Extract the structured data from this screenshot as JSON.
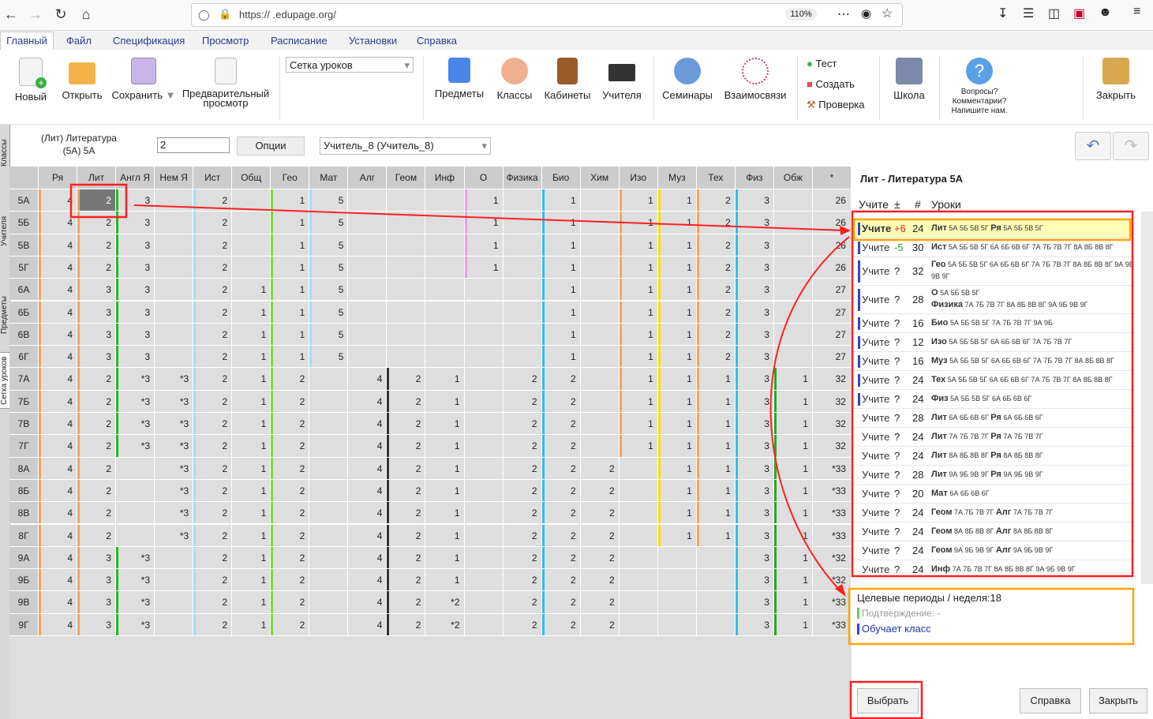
{
  "browser": {
    "url": "https://       .edupage.org/",
    "zoom": "110%"
  },
  "menu": [
    "Главный",
    "Файл",
    "Спецификация",
    "Просмотр",
    "Расписание",
    "Установки",
    "Справка"
  ],
  "toolbar": {
    "new": "Новый",
    "open": "Открыть",
    "save": "Сохранить",
    "preview": [
      "Предварительный",
      "просмотр"
    ],
    "view_select": "Сетка уроков",
    "subjects": "Предметы",
    "classes": "Классы",
    "rooms": "Кабинеты",
    "teachers": "Учителя",
    "seminars": "Семинары",
    "relations": "Взаимосвязи",
    "test": "Тест",
    "create": "Создать",
    "check": "Проверка",
    "school": "Школа",
    "questions": [
      "Вопросы?",
      "Комментарии?",
      "Напишите нам."
    ],
    "close": "Закрыть"
  },
  "vertical_tabs": [
    "Сетка уроков",
    "Предметы",
    "Учителя",
    "Классы"
  ],
  "header": {
    "subject_line1": "(Лит) Литература",
    "subject_line2": "(5А) 5А",
    "count_value": "2",
    "options_label": "Опции",
    "teacher_select": "Учитель_8 (Учитель_8)"
  },
  "grid": {
    "columns": [
      "Ря",
      "Лит",
      "Англ Я",
      "Нем Я",
      "Ист",
      "Общ",
      "Гео",
      "Мат",
      "Алг",
      "Геом",
      "Инф",
      "О",
      "Физика",
      "Био",
      "Хим",
      "Изо",
      "Муз",
      "Тех",
      "Физ",
      "Обж",
      "*"
    ],
    "column_colors": [
      "#f5a35c",
      "#f5a35c",
      "#22bb22",
      "#cccccc",
      "#99e0ff",
      "#cccccc",
      "#77dd33",
      "#99e0ff",
      "#cccccc",
      "#333333",
      "#cccccc",
      "#ee99ee",
      "#cccccc",
      "#33bbee",
      "#cccccc",
      "#f5a35c",
      "#f3e000",
      "#f5a35c",
      "#33bbee",
      "#22aa22",
      "#cccccc"
    ],
    "rows": [
      {
        "label": "5А",
        "cells": [
          "4",
          "2",
          "3",
          "",
          "2",
          "",
          "1",
          "5",
          "",
          "",
          "",
          "1",
          "",
          "1",
          "",
          "1",
          "1",
          "2",
          "3",
          "",
          "26"
        ]
      },
      {
        "label": "5Б",
        "cells": [
          "4",
          "2",
          "3",
          "",
          "2",
          "",
          "1",
          "5",
          "",
          "",
          "",
          "1",
          "",
          "1",
          "",
          "1",
          "1",
          "2",
          "3",
          "",
          "26"
        ]
      },
      {
        "label": "5В",
        "cells": [
          "4",
          "2",
          "3",
          "",
          "2",
          "",
          "1",
          "5",
          "",
          "",
          "",
          "1",
          "",
          "1",
          "",
          "1",
          "1",
          "2",
          "3",
          "",
          "26"
        ]
      },
      {
        "label": "5Г",
        "cells": [
          "4",
          "2",
          "3",
          "",
          "2",
          "",
          "1",
          "5",
          "",
          "",
          "",
          "1",
          "",
          "1",
          "",
          "1",
          "1",
          "2",
          "3",
          "",
          "26"
        ]
      },
      {
        "label": "6А",
        "cells": [
          "4",
          "3",
          "3",
          "",
          "2",
          "1",
          "1",
          "5",
          "",
          "",
          "",
          "",
          "",
          "1",
          "",
          "1",
          "1",
          "2",
          "3",
          "",
          "27"
        ]
      },
      {
        "label": "6Б",
        "cells": [
          "4",
          "3",
          "3",
          "",
          "2",
          "1",
          "1",
          "5",
          "",
          "",
          "",
          "",
          "",
          "1",
          "",
          "1",
          "1",
          "2",
          "3",
          "",
          "27"
        ]
      },
      {
        "label": "6В",
        "cells": [
          "4",
          "3",
          "3",
          "",
          "2",
          "1",
          "1",
          "5",
          "",
          "",
          "",
          "",
          "",
          "1",
          "",
          "1",
          "1",
          "2",
          "3",
          "",
          "27"
        ]
      },
      {
        "label": "6Г",
        "cells": [
          "4",
          "3",
          "3",
          "",
          "2",
          "1",
          "1",
          "5",
          "",
          "",
          "",
          "",
          "",
          "1",
          "",
          "1",
          "1",
          "2",
          "3",
          "",
          "27"
        ]
      },
      {
        "label": "7А",
        "cells": [
          "4",
          "2",
          "*3",
          "*3",
          "2",
          "1",
          "2",
          "",
          "4",
          "2",
          "1",
          "",
          "2",
          "2",
          "",
          "1",
          "1",
          "1",
          "3",
          "1",
          "32"
        ]
      },
      {
        "label": "7Б",
        "cells": [
          "4",
          "2",
          "*3",
          "*3",
          "2",
          "1",
          "2",
          "",
          "4",
          "2",
          "1",
          "",
          "2",
          "2",
          "",
          "1",
          "1",
          "1",
          "3",
          "1",
          "32"
        ]
      },
      {
        "label": "7В",
        "cells": [
          "4",
          "2",
          "*3",
          "*3",
          "2",
          "1",
          "2",
          "",
          "4",
          "2",
          "1",
          "",
          "2",
          "2",
          "",
          "1",
          "1",
          "1",
          "3",
          "1",
          "32"
        ]
      },
      {
        "label": "7Г",
        "cells": [
          "4",
          "2",
          "*3",
          "*3",
          "2",
          "1",
          "2",
          "",
          "4",
          "2",
          "1",
          "",
          "2",
          "2",
          "",
          "1",
          "1",
          "1",
          "3",
          "1",
          "32"
        ]
      },
      {
        "label": "8А",
        "cells": [
          "4",
          "2",
          "",
          "*3",
          "2",
          "1",
          "2",
          "",
          "4",
          "2",
          "1",
          "",
          "2",
          "2",
          "2",
          "",
          "1",
          "1",
          "3",
          "1",
          "*33"
        ]
      },
      {
        "label": "8Б",
        "cells": [
          "4",
          "2",
          "",
          "*3",
          "2",
          "1",
          "2",
          "",
          "4",
          "2",
          "1",
          "",
          "2",
          "2",
          "2",
          "",
          "1",
          "1",
          "3",
          "1",
          "*33"
        ]
      },
      {
        "label": "8В",
        "cells": [
          "4",
          "2",
          "",
          "*3",
          "2",
          "1",
          "2",
          "",
          "4",
          "2",
          "1",
          "",
          "2",
          "2",
          "2",
          "",
          "1",
          "1",
          "3",
          "1",
          "*33"
        ]
      },
      {
        "label": "8Г",
        "cells": [
          "4",
          "2",
          "",
          "*3",
          "2",
          "1",
          "2",
          "",
          "4",
          "2",
          "1",
          "",
          "2",
          "2",
          "2",
          "",
          "1",
          "1",
          "3",
          "1",
          "*33"
        ]
      },
      {
        "label": "9А",
        "cells": [
          "4",
          "3",
          "*3",
          "",
          "2",
          "1",
          "2",
          "",
          "4",
          "2",
          "1",
          "",
          "2",
          "2",
          "2",
          "",
          "",
          "",
          "3",
          "1",
          "*32"
        ]
      },
      {
        "label": "9Б",
        "cells": [
          "4",
          "3",
          "*3",
          "",
          "2",
          "1",
          "2",
          "",
          "4",
          "2",
          "1",
          "",
          "2",
          "2",
          "2",
          "",
          "",
          "",
          "3",
          "1",
          "*32"
        ]
      },
      {
        "label": "9В",
        "cells": [
          "4",
          "3",
          "*3",
          "",
          "2",
          "1",
          "2",
          "",
          "4",
          "2",
          "*2",
          "",
          "2",
          "2",
          "2",
          "",
          "",
          "",
          "3",
          "1",
          "*33"
        ]
      },
      {
        "label": "9Г",
        "cells": [
          "4",
          "3",
          "*3",
          "",
          "2",
          "1",
          "2",
          "",
          "4",
          "2",
          "*2",
          "",
          "2",
          "2",
          "2",
          "",
          "",
          "",
          "3",
          "1",
          "*33"
        ]
      }
    ]
  },
  "panel": {
    "title": "Лит - Литература  5А",
    "col_teacher": "Учите",
    "col_diff": "±",
    "col_num": "#",
    "col_lessons": "Уроки",
    "rows": [
      {
        "t": "Учите",
        "d": "+6",
        "dc": "#e02020",
        "n": "24",
        "bar": "#3344cc",
        "lessons": [
          [
            "Лит",
            "5А 5Б 5В 5Г"
          ],
          [
            "Ря",
            "5А 5Б 5В 5Г"
          ]
        ],
        "hl": true
      },
      {
        "t": "Учите",
        "d": "-5",
        "dc": "#22aa22",
        "n": "30",
        "bar": "#3344cc",
        "lessons": [
          [
            "Ист",
            "5А 5Б 5В 5Г 6А 6Б 6В 6Г 7А 7Б 7В 7Г 8А 8Б 8В 8Г"
          ]
        ]
      },
      {
        "t": "Учите",
        "d": "?",
        "n": "32",
        "bar": "#3344cc",
        "lessons": [
          [
            "Гео",
            "5А 5Б 5В 5Г 6А 6Б 6В 6Г 7А 7Б 7В 7Г 8А 8Б 8В 8Г 9А 9Б 9В 9Г"
          ]
        ],
        "tall": true
      },
      {
        "t": "Учите",
        "d": "?",
        "n": "28",
        "bar": "#3344cc",
        "lessons": [
          [
            "О",
            "5А 5Б 5В 5Г"
          ],
          [
            "Физика",
            "7А 7Б 7В 7Г 8А 8Б 8В 8Г 9А 9Б 9В 9Г"
          ]
        ],
        "tall": true,
        "split": true
      },
      {
        "t": "Учите",
        "d": "?",
        "n": "16",
        "bar": "#3344cc",
        "lessons": [
          [
            "Био",
            "5А 5Б 5В 5Г 7А 7Б 7В 7Г 9А 9Б"
          ]
        ]
      },
      {
        "t": "Учите",
        "d": "?",
        "n": "12",
        "bar": "#3344cc",
        "lessons": [
          [
            "Изо",
            "5А 5Б 5В 5Г 6А 6Б 6В 6Г 7А 7Б 7В 7Г"
          ]
        ]
      },
      {
        "t": "Учите",
        "d": "?",
        "n": "16",
        "bar": "#3344cc",
        "lessons": [
          [
            "Муз",
            "5А 5Б 5В 5Г 6А 6Б 6В 6Г 7А 7Б 7В 7Г 8А 8Б 8В 8Г"
          ]
        ]
      },
      {
        "t": "Учите",
        "d": "?",
        "n": "24",
        "bar": "#3344cc",
        "lessons": [
          [
            "Тех",
            "5А 5Б 5В 5Г 6А 6Б 6В 6Г 7А 7Б 7В 7Г 8А 8Б 8В 8Г"
          ]
        ]
      },
      {
        "t": "Учите",
        "d": "?",
        "n": "24",
        "bar": "#3344cc",
        "lessons": [
          [
            "Физ",
            "5А 5Б 5В 5Г 6А 6Б 6В 6Г"
          ]
        ]
      },
      {
        "t": "Учите",
        "d": "?",
        "n": "28",
        "lessons": [
          [
            "Лит",
            "6А 6Б 6В 6Г"
          ],
          [
            "Ря",
            "6А 6Б 6В 6Г"
          ]
        ]
      },
      {
        "t": "Учите",
        "d": "?",
        "n": "24",
        "lessons": [
          [
            "Лит",
            "7А 7Б 7В 7Г"
          ],
          [
            "Ря",
            "7А 7Б 7В 7Г"
          ]
        ]
      },
      {
        "t": "Учите",
        "d": "?",
        "n": "24",
        "lessons": [
          [
            "Лит",
            "8А 8Б 8В 8Г"
          ],
          [
            "Ря",
            "8А 8Б 8В 8Г"
          ]
        ]
      },
      {
        "t": "Учите",
        "d": "?",
        "n": "28",
        "lessons": [
          [
            "Лит",
            "9А 9Б 9В 9Г"
          ],
          [
            "Ря",
            "9А 9Б 9В 9Г"
          ]
        ]
      },
      {
        "t": "Учите",
        "d": "?",
        "n": "20",
        "lessons": [
          [
            "Мат",
            "6А 6Б 6В 6Г"
          ]
        ]
      },
      {
        "t": "Учите",
        "d": "?",
        "n": "24",
        "lessons": [
          [
            "Геом",
            "7А 7Б 7В 7Г"
          ],
          [
            "Алг",
            "7А 7Б 7В 7Г"
          ]
        ]
      },
      {
        "t": "Учите",
        "d": "?",
        "n": "24",
        "lessons": [
          [
            "Геом",
            "8А 8Б 8В 8Г"
          ],
          [
            "Алг",
            "8А 8Б 8В 8Г"
          ]
        ]
      },
      {
        "t": "Учите",
        "d": "?",
        "n": "24",
        "lessons": [
          [
            "Геом",
            "9А 9Б 9В 9Г"
          ],
          [
            "Алг",
            "9А 9Б 9В 9Г"
          ]
        ]
      },
      {
        "t": "Учите",
        "d": "?",
        "n": "24",
        "lessons": [
          [
            "Инф",
            "7А 7Б 7В 7Г 8А 8Б 8В 8Г 9А 9Б 9В 9Г"
          ]
        ]
      }
    ],
    "target": "Целевые периоды / неделя:18",
    "confirmation": "Подтверждение: -",
    "teaches_class": "Обучает класс",
    "select_btn": "Выбрать",
    "help_btn": "Справка",
    "close_btn": "Закрыть"
  }
}
